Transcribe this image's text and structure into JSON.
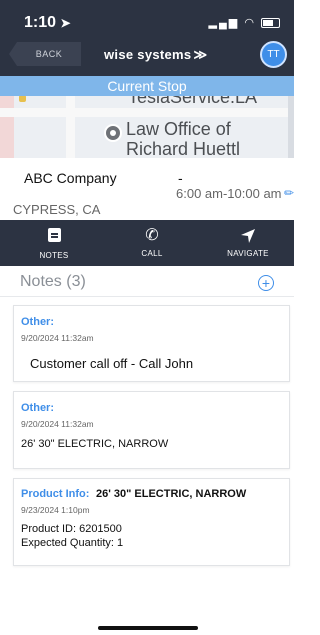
{
  "status_bar": {
    "time": "1:10",
    "location_arrow": "location-arrow-icon"
  },
  "header": {
    "back_label": "BACK",
    "brand": "wise systems",
    "brand_chevrons": "≫",
    "avatar_initials": "TT",
    "current_stop_label": "Current Stop"
  },
  "map": {
    "labels": [
      "TeslaService.LA",
      "Law Office of",
      "Richard Huettl"
    ]
  },
  "stop": {
    "company": "ABC Company",
    "dash": "-",
    "time_window": "6:00 am-10:00 am",
    "city": "CYPRESS, CA"
  },
  "actions": [
    {
      "label": "NOTES",
      "icon": "notes-icon"
    },
    {
      "label": "CALL",
      "icon": "phone-icon"
    },
    {
      "label": "NAVIGATE",
      "icon": "navigate-arrow-icon"
    }
  ],
  "notes": {
    "header": "Notes (3)",
    "add_icon": "plus-circle-icon",
    "items": [
      {
        "category": "Other:",
        "date": "9/20/2024 11:32am",
        "text": "Customer call off - Call John"
      },
      {
        "category": "Other:",
        "date": "9/20/2024 11:32am",
        "text": "26' 30\" ELECTRIC, NARROW"
      },
      {
        "category": "Product Info:",
        "title": "26' 30\" ELECTRIC, NARROW",
        "date": "9/23/2024 1:10pm",
        "product_id": "Product ID: 6201500",
        "expected_qty": "Expected Quantity: 1"
      }
    ]
  },
  "colors": {
    "nav_bg": "#2c3342",
    "accent": "#3f8ee8",
    "current_stop_bg": "#7fb6ea"
  }
}
